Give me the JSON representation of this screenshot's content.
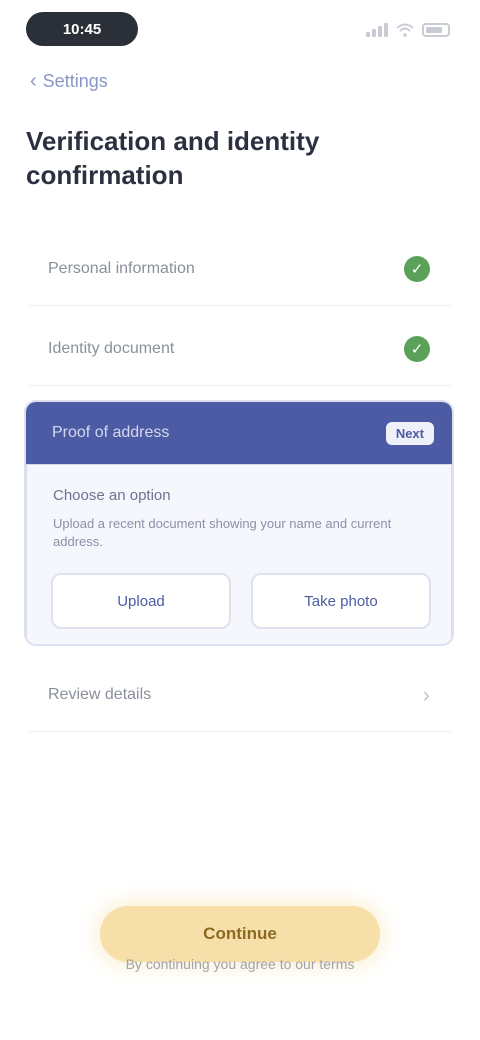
{
  "status_bar": {
    "time": "10:45"
  },
  "nav": {
    "back_label": "Settings"
  },
  "title": "Verification and identity confirmation",
  "rows": [
    {
      "label": "Personal information",
      "state": "done"
    },
    {
      "label": "Identity document",
      "state": "done"
    }
  ],
  "card": {
    "title": "Proof of address",
    "badge": "Next",
    "subtitle": "Choose an option",
    "text": "Upload a recent document showing your name and current address.",
    "buttons": [
      "Upload",
      "Take photo"
    ]
  },
  "last_row": {
    "label": "Review details"
  },
  "cta": {
    "label": "Continue",
    "legal": "By continuing you agree to our terms"
  },
  "colors": {
    "accent": "#4c5ba3",
    "success": "#5aa25a",
    "cta": "#f6dfa9"
  }
}
